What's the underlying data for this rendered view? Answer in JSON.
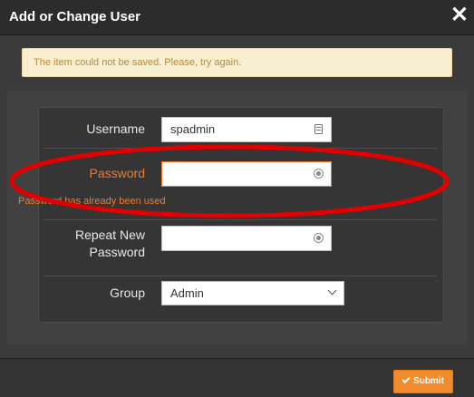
{
  "dialog": {
    "title": "Add or Change User",
    "close_label": "✕"
  },
  "alert": {
    "text": "The item could not be saved. Please, try again."
  },
  "form": {
    "username_label": "Username",
    "username_value": "spadmin",
    "password_label": "Password",
    "password_value": "",
    "password_error": "Password has already been used",
    "repeat_label_line1": "Repeat New",
    "repeat_label_line2": "Password",
    "repeat_value": "",
    "group_label": "Group",
    "group_value": "Admin"
  },
  "footer": {
    "submit_label": "Submit"
  },
  "colors": {
    "accent": "#f28b2d",
    "error": "#f07b2e",
    "annotation": "#e00000"
  },
  "icons": {
    "username": "id-card-icon",
    "password": "eye-icon",
    "repeat": "eye-icon",
    "group": "chevron-down-icon",
    "submit": "check-icon"
  }
}
